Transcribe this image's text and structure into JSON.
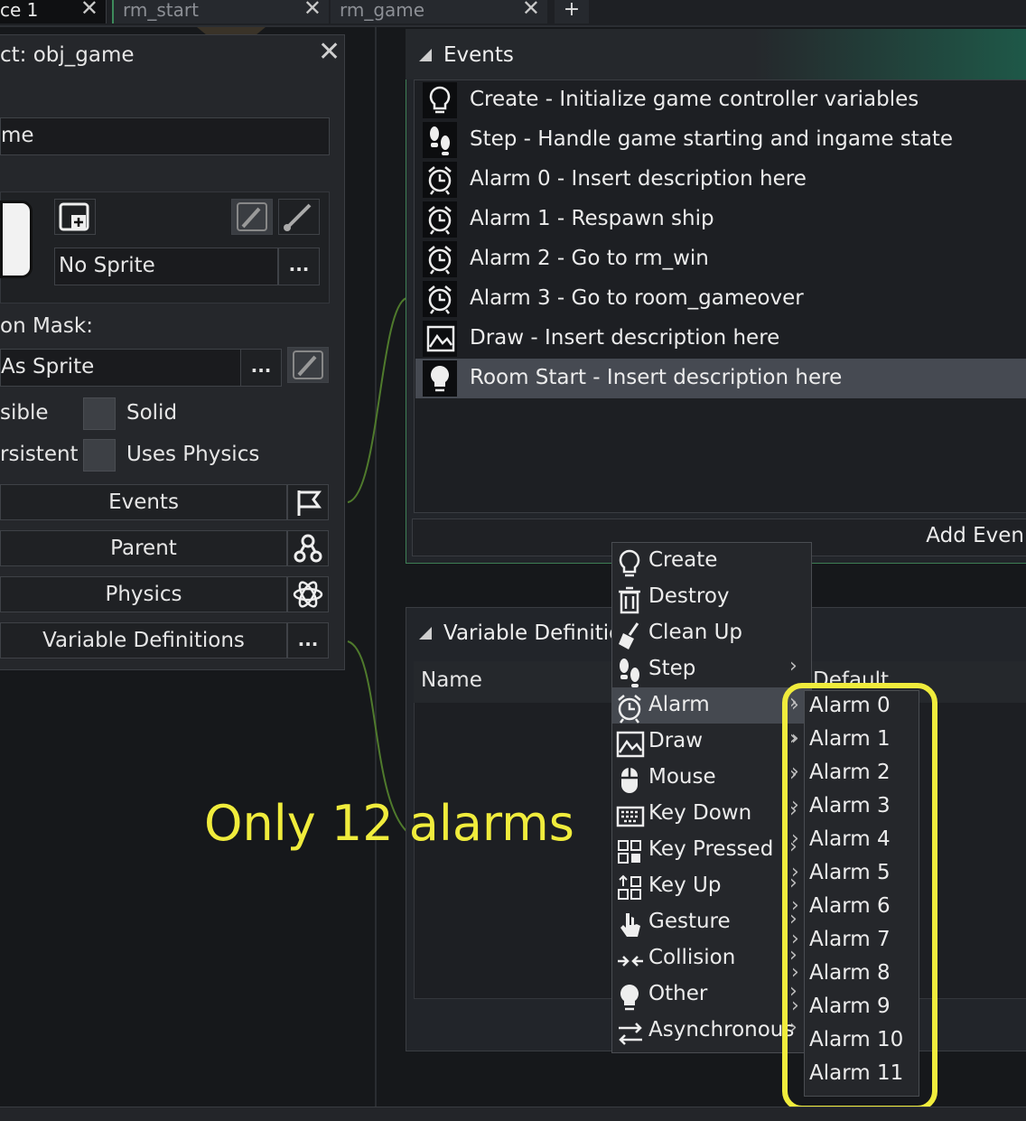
{
  "tabs": [
    {
      "label": "ce 1"
    },
    {
      "label": "rm_start"
    },
    {
      "label": "rm_game"
    }
  ],
  "tab_add_label": "+",
  "object_panel": {
    "title": "ct: obj_game",
    "name_value": "me",
    "sprite_value": "No Sprite",
    "collision_mask_label": "on Mask:",
    "mask_value": "As Sprite",
    "visible_label": "sible",
    "solid_label": "Solid",
    "persistent_label": "rsistent",
    "uses_physics_label": "Uses Physics",
    "buttons": {
      "events": "Events",
      "parent": "Parent",
      "physics": "Physics",
      "variable_definitions": "Variable Definitions"
    },
    "dots": "..."
  },
  "events_panel": {
    "title": "Events",
    "events": [
      {
        "label": "Create - Initialize game controller variables",
        "icon": "lightbulb-icon"
      },
      {
        "label": "Step - Handle game starting and ingame state",
        "icon": "footsteps-icon"
      },
      {
        "label": "Alarm 0 - Insert description here",
        "icon": "alarm-clock-icon"
      },
      {
        "label": "Alarm 1 - Respawn ship",
        "icon": "alarm-clock-icon"
      },
      {
        "label": "Alarm 2 - Go to rm_win",
        "icon": "alarm-clock-icon"
      },
      {
        "label": "Alarm 3 - Go to room_gameover",
        "icon": "alarm-clock-icon"
      },
      {
        "label": "Draw - Insert description here",
        "icon": "picture-icon"
      },
      {
        "label": "Room Start - Insert description here",
        "icon": "lightbulb-filled-icon",
        "selected": true
      }
    ],
    "add_event_label": "Add Even"
  },
  "variable_definitions_panel": {
    "title": "Variable Definitio",
    "col_name": "Name",
    "col_default": "Default"
  },
  "context_menu": {
    "items": [
      {
        "label": "Create",
        "icon": "lightbulb-icon",
        "submenu": false
      },
      {
        "label": "Destroy",
        "icon": "trash-icon",
        "submenu": false
      },
      {
        "label": "Clean Up",
        "icon": "broom-icon",
        "submenu": false
      },
      {
        "label": "Step",
        "icon": "footsteps-icon",
        "submenu": true
      },
      {
        "label": "Alarm",
        "icon": "alarm-clock-icon",
        "submenu": true,
        "selected": true
      },
      {
        "label": "Draw",
        "icon": "picture-icon",
        "submenu": true
      },
      {
        "label": "Mouse",
        "icon": "mouse-icon",
        "submenu": true
      },
      {
        "label": "Key Down",
        "icon": "keyboard-icon",
        "submenu": true
      },
      {
        "label": "Key Pressed",
        "icon": "key-pressed-icon",
        "submenu": true
      },
      {
        "label": "Key Up",
        "icon": "key-up-icon",
        "submenu": true
      },
      {
        "label": "Gesture",
        "icon": "hand-pointer-icon",
        "submenu": true
      },
      {
        "label": "Collision",
        "icon": "collision-arrows-icon",
        "submenu": true
      },
      {
        "label": "Other",
        "icon": "lightbulb-filled-icon",
        "submenu": true
      },
      {
        "label": "Asynchronous",
        "icon": "swap-arrows-icon",
        "submenu": true
      }
    ]
  },
  "alarm_submenu": {
    "items": [
      "Alarm 0",
      "Alarm 1",
      "Alarm 2",
      "Alarm 3",
      "Alarm 4",
      "Alarm 5",
      "Alarm 6",
      "Alarm 7",
      "Alarm 8",
      "Alarm 9",
      "Alarm 10",
      "Alarm 11"
    ]
  },
  "annotation": {
    "text": "Only 12 alarms",
    "color": "#f0ec3c"
  },
  "colors": {
    "accent_green": "#3e7f55",
    "highlight_yellow": "#f0ec3c",
    "selection": "#464a52"
  }
}
